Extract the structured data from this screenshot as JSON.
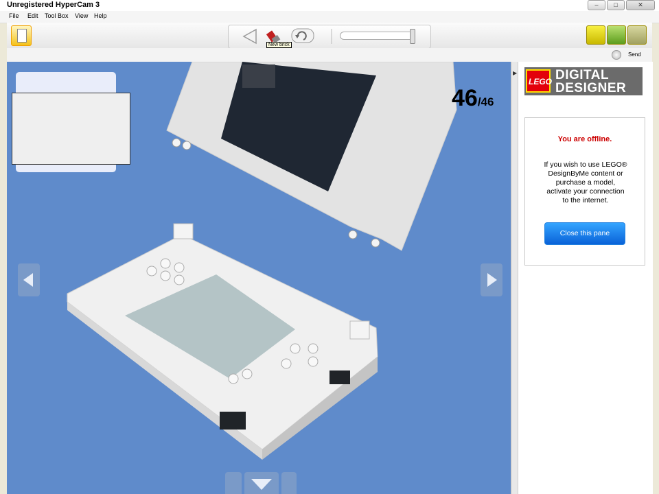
{
  "window": {
    "title": "Unregistered HyperCam 3"
  },
  "menu": {
    "items": [
      "File",
      "Edit",
      "Tool Box",
      "View",
      "Help"
    ]
  },
  "toolbar": {
    "tooltip": "New brick"
  },
  "subbar": {
    "send_label": "Send"
  },
  "viewport": {
    "step_current": "46",
    "step_total": "/46"
  },
  "panel": {
    "logo_brand": "LEGO",
    "logo_line1": "DIGITAL",
    "logo_line2": "DESIGNER",
    "offline_title": "You are offline.",
    "offline_message": "If you wish to use LEGO®\nDesignByMe content or\npurchase a model,\nactivate your connection\nto the internet.",
    "close_button": "Close this pane"
  },
  "colors": {
    "viewport_bg": "#5f8bcb",
    "offline_red": "#cc0000",
    "button_blue": "#0a62d8"
  }
}
